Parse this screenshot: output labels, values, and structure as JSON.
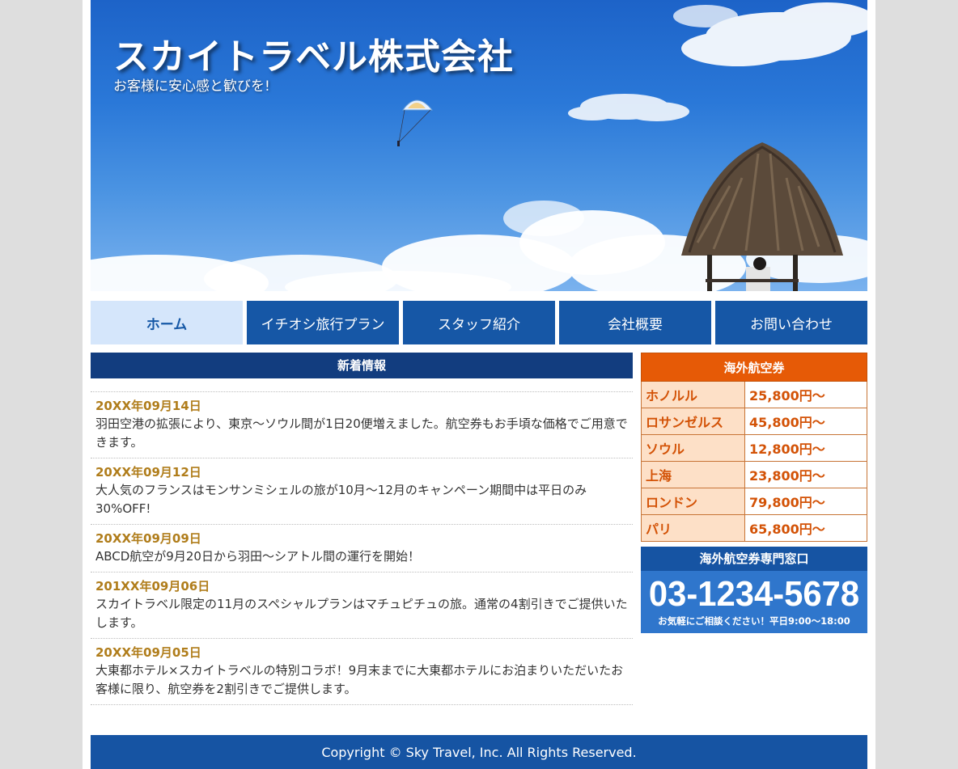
{
  "header": {
    "title": "スカイトラベル株式会社",
    "subtitle": "お客様に安心感と歓びを!"
  },
  "nav": {
    "items": [
      {
        "label": "ホーム",
        "active": true
      },
      {
        "label": "イチオシ旅行プラン",
        "active": false
      },
      {
        "label": "スタッフ紹介",
        "active": false
      },
      {
        "label": "会社概要",
        "active": false
      },
      {
        "label": "お問い合わせ",
        "active": false
      }
    ]
  },
  "news": {
    "heading": "新着情報",
    "items": [
      {
        "date": "20XX年09月14日",
        "text": "羽田空港の拡張により、東京～ソウル間が1日20便増えました。航空券もお手頃な価格でご用意できます。"
      },
      {
        "date": "20XX年09月12日",
        "text": "大人気のフランスはモンサンミシェルの旅が10月～12月のキャンペーン期間中は平日のみ30%OFF!"
      },
      {
        "date": "20XX年09月09日",
        "text": "ABCD航空が9月20日から羽田～シアトル間の運行を開始！"
      },
      {
        "date": "201XX年09月06日",
        "text": "スカイトラベル限定の11月のスペシャルプランはマチュピチュの旅。通常の4割引きでご提供いたします。"
      },
      {
        "date": "20XX年09月05日",
        "text": "大東都ホテル×スカイトラベルの特別コラボ！9月末までに大東都ホテルにお泊まりいただいたお客様に限り、航空券を2割引きでご提供します。"
      }
    ]
  },
  "fares": {
    "heading": "海外航空券",
    "rows": [
      {
        "city": "ホノルル",
        "price": "25,800円～"
      },
      {
        "city": "ロサンゼルス",
        "price": "45,800円～"
      },
      {
        "city": "ソウル",
        "price": "12,800円～"
      },
      {
        "city": "上海",
        "price": "23,800円～"
      },
      {
        "city": "ロンドン",
        "price": "79,800円～"
      },
      {
        "city": "パリ",
        "price": "65,800円～"
      }
    ]
  },
  "contact": {
    "heading": "海外航空券専門窓口",
    "phone": "03-1234-5678",
    "note": "お気軽にご相談ください！平日9:00～18:00"
  },
  "footer": {
    "copyright": "Copyright © Sky Travel, Inc. All Rights Reserved."
  },
  "colors": {
    "nav": "#1657a6",
    "nav_active": "#d5e6fb",
    "news_header": "#123d7f",
    "news_date": "#b07d1b",
    "fare_header": "#e65a06",
    "fare_city_bg": "#fde0c7",
    "footer": "#1654a3"
  }
}
